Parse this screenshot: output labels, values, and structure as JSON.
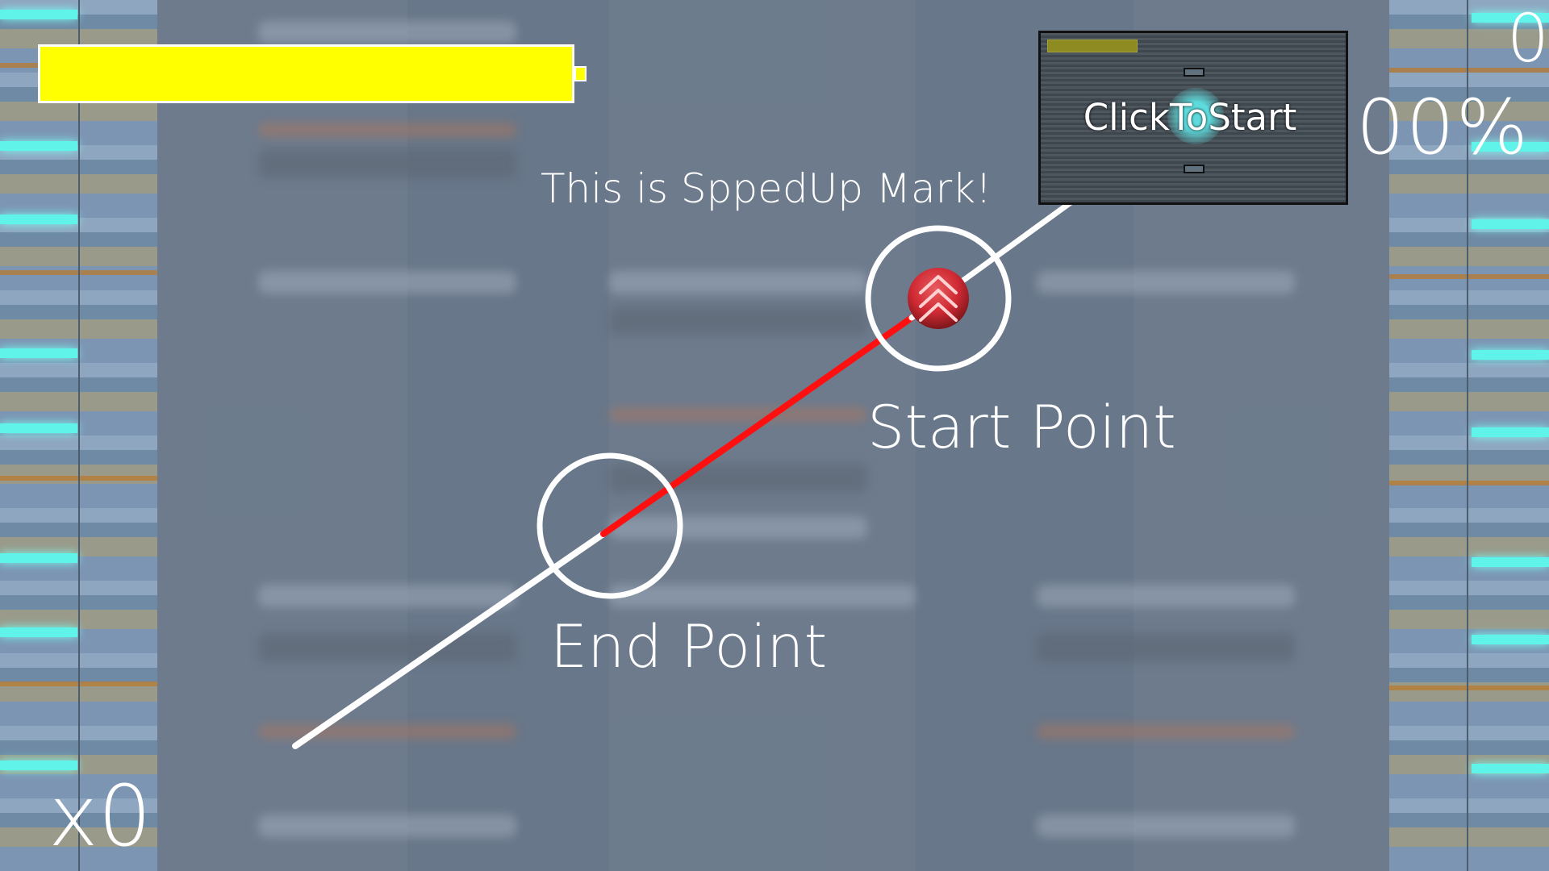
{
  "hud": {
    "score": "0",
    "accuracy": "100%",
    "combo": "x0",
    "health_fraction": 1.0
  },
  "preview": {
    "label": "ClickToStart"
  },
  "tutorial": {
    "note_label": "This is SppedUp Mark!",
    "start_label": "Start Point",
    "end_label": "End Point"
  },
  "colors": {
    "health": "#ffff00",
    "accent": "#5ff3ea",
    "slide_active": "#ff1010",
    "marker": "#d02a34"
  },
  "icons": {
    "speed_up_mark": "double-chevron-up-icon"
  }
}
